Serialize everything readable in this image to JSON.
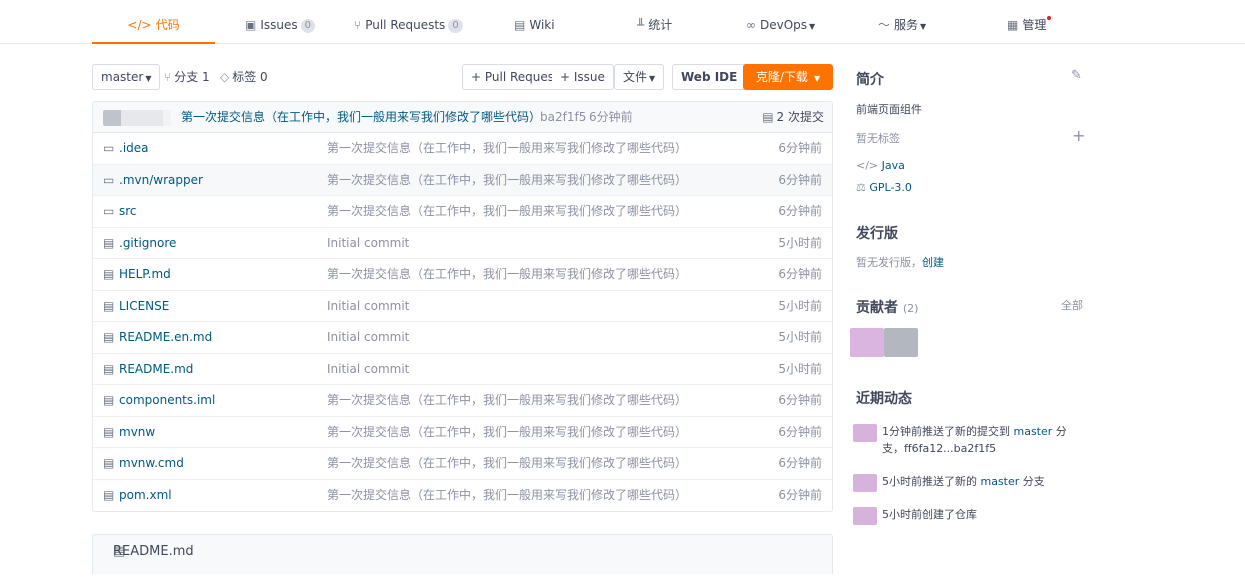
{
  "tabs": [
    {
      "label": "代码",
      "icon": "</>"
    },
    {
      "label": "Issues",
      "count": "0"
    },
    {
      "label": "Pull Requests",
      "count": "0"
    },
    {
      "label": "Wiki"
    },
    {
      "label": "统计"
    },
    {
      "label": "DevOps"
    },
    {
      "label": "服务"
    },
    {
      "label": "管理"
    }
  ],
  "toolbar": {
    "branch": "master",
    "branches": "分支 1",
    "tags": "标签 0",
    "pull_request": "+ Pull Request",
    "issue": "+ Issue",
    "file": "文件",
    "web_ide": "Web IDE",
    "clone": "克隆/下载"
  },
  "commit": {
    "message": "第一次提交信息（在工作中，我们一般用来写我们修改了哪些代码）",
    "sha": "ba2f1f5",
    "time": "6分钟前",
    "count": "2 次提交"
  },
  "files": [
    {
      "name": ".idea",
      "type": "folder",
      "message": "第一次提交信息（在工作中，我们一般用来写我们修改了哪些代码）",
      "time": "6分钟前"
    },
    {
      "name": ".mvn/wrapper",
      "type": "folder",
      "message": "第一次提交信息（在工作中，我们一般用来写我们修改了哪些代码）",
      "time": "6分钟前"
    },
    {
      "name": "src",
      "type": "folder",
      "message": "第一次提交信息（在工作中，我们一般用来写我们修改了哪些代码）",
      "time": "6分钟前"
    },
    {
      "name": ".gitignore",
      "type": "file",
      "message": "Initial commit",
      "time": "5小时前"
    },
    {
      "name": "HELP.md",
      "type": "file",
      "message": "第一次提交信息（在工作中，我们一般用来写我们修改了哪些代码）",
      "time": "6分钟前"
    },
    {
      "name": "LICENSE",
      "type": "file",
      "message": "Initial commit",
      "time": "5小时前"
    },
    {
      "name": "README.en.md",
      "type": "file",
      "message": "Initial commit",
      "time": "5小时前"
    },
    {
      "name": "README.md",
      "type": "file",
      "message": "Initial commit",
      "time": "5小时前"
    },
    {
      "name": "components.iml",
      "type": "file",
      "message": "第一次提交信息（在工作中，我们一般用来写我们修改了哪些代码）",
      "time": "6分钟前"
    },
    {
      "name": "mvnw",
      "type": "file",
      "message": "第一次提交信息（在工作中，我们一般用来写我们修改了哪些代码）",
      "time": "6分钟前"
    },
    {
      "name": "mvnw.cmd",
      "type": "file",
      "message": "第一次提交信息（在工作中，我们一般用来写我们修改了哪些代码）",
      "time": "6分钟前"
    },
    {
      "name": "pom.xml",
      "type": "file",
      "message": "第一次提交信息（在工作中，我们一般用来写我们修改了哪些代码）",
      "time": "6分钟前"
    }
  ],
  "readme_title": "README.md",
  "sidebar": {
    "intro_title": "简介",
    "description": "前端页面组件",
    "no_tags": "暂无标签",
    "language": "Java",
    "license": "GPL-3.0",
    "release_title": "发行版",
    "no_release": "暂无发行版，",
    "create": "创建",
    "contributors_title": "贡献者",
    "contributors_count": "(2)",
    "all": "全部",
    "activity_title": "近期动态",
    "activities": [
      {
        "pre": "1分钟前推送了新的提交到 ",
        "branch": "master",
        "post": " 分支，ff6fa12...ba2f1f5"
      },
      {
        "pre": "5小时前推送了新的 ",
        "branch": "master",
        "post": " 分支"
      },
      {
        "pre": "5小时前创建了仓库",
        "branch": "",
        "post": ""
      }
    ]
  }
}
